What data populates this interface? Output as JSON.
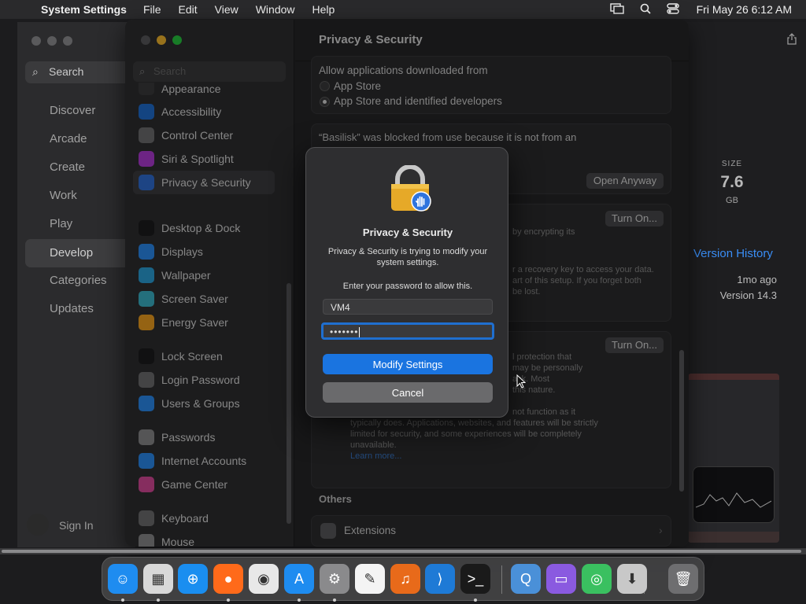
{
  "menubar": {
    "app_name": "System Settings",
    "menus": [
      "File",
      "Edit",
      "View",
      "Window",
      "Help"
    ],
    "clock": "Fri May 26  6:12 AM"
  },
  "appstore": {
    "search_label": "Search",
    "nav": [
      "Discover",
      "Arcade",
      "Create",
      "Work",
      "Play",
      "Develop",
      "Categories",
      "Updates"
    ],
    "active_nav": "Develop",
    "sign_in": "Sign In",
    "size_label": "SIZE",
    "size_value": "7.6",
    "size_unit": "GB",
    "version_history": "Version History",
    "updated_ago": "1mo ago",
    "version": "Version 14.3"
  },
  "settings": {
    "search_placeholder": "Search",
    "sidebar_groups": [
      [
        {
          "label": "Appearance",
          "icon": "appearance-icon",
          "color": "#3a3a3c"
        },
        {
          "label": "Accessibility",
          "icon": "accessibility-icon",
          "color": "#1f6fd0"
        },
        {
          "label": "Control Center",
          "icon": "control-center-icon",
          "color": "#6e6e70"
        },
        {
          "label": "Siri & Spotlight",
          "icon": "siri-icon",
          "color": "#b03bd6"
        },
        {
          "label": "Privacy & Security",
          "icon": "privacy-hand-icon",
          "color": "#2f6fd6"
        }
      ],
      [
        {
          "label": "Desktop & Dock",
          "icon": "desktop-dock-icon",
          "color": "#1c1c1e"
        },
        {
          "label": "Displays",
          "icon": "displays-icon",
          "color": "#2a8cf0"
        },
        {
          "label": "Wallpaper",
          "icon": "wallpaper-icon",
          "color": "#2aa0d8"
        },
        {
          "label": "Screen Saver",
          "icon": "screen-saver-icon",
          "color": "#3ab4c8"
        },
        {
          "label": "Energy Saver",
          "icon": "energy-saver-icon",
          "color": "#f0a020"
        }
      ],
      [
        {
          "label": "Lock Screen",
          "icon": "lock-screen-icon",
          "color": "#1c1c1e"
        },
        {
          "label": "Login Password",
          "icon": "login-password-icon",
          "color": "#6e6e70"
        },
        {
          "label": "Users & Groups",
          "icon": "users-groups-icon",
          "color": "#2a8cf0"
        }
      ],
      [
        {
          "label": "Passwords",
          "icon": "passwords-key-icon",
          "color": "#8a8a8c"
        },
        {
          "label": "Internet Accounts",
          "icon": "internet-accounts-icon",
          "color": "#2a8cf0"
        },
        {
          "label": "Game Center",
          "icon": "game-center-icon",
          "color": "#d84a9a"
        }
      ],
      [
        {
          "label": "Keyboard",
          "icon": "keyboard-icon",
          "color": "#6e6e70"
        },
        {
          "label": "Mouse",
          "icon": "mouse-icon",
          "color": "#8a8a8c"
        }
      ]
    ],
    "active_item": "Privacy & Security",
    "detail_title": "Privacy & Security",
    "allow_label": "Allow applications downloaded from",
    "radio_app_store": "App Store",
    "radio_identified": "App Store and identified developers",
    "blocked_text": "“Basilisk” was blocked from use because it is not from an",
    "open_anyway": "Open Anyway",
    "turn_on_1": "Turn On...",
    "turn_on_2": "Turn On...",
    "filevault_frag_1": "by encrypting its",
    "filevault_frag_2": "r a recovery key to access your data.",
    "filevault_frag_3": "art of this setup. If you forget both",
    "filevault_frag_4": "be lost.",
    "lockdown_frag_1": "l protection that",
    "lockdown_frag_2": "may be personally",
    "lockdown_frag_3": "ack. Most",
    "lockdown_frag_4": "this nature.",
    "lockdown_frag_5": "not function as it",
    "lockdown_body": "typically does. Applications, websites, and features will be strictly limited for security, and some experiences will be completely unavailable.",
    "learn_more": "Learn more...",
    "others_header": "Others",
    "extensions": "Extensions"
  },
  "dialog": {
    "title": "Privacy & Security",
    "message": "Privacy & Security is trying to modify your system settings.",
    "prompt": "Enter your password to allow this.",
    "username": "VM4",
    "password_mask": "•••••••",
    "modify_button": "Modify Settings",
    "cancel_button": "Cancel"
  },
  "dock": {
    "apps": [
      {
        "name": "finder-icon",
        "glyph": "☺",
        "color": "#1e8cf0",
        "running": true
      },
      {
        "name": "launchpad-icon",
        "glyph": "▦",
        "color": "#d8d8d8",
        "running": true
      },
      {
        "name": "safari-icon",
        "glyph": "⊕",
        "color": "#1a8ef0",
        "running": false
      },
      {
        "name": "firefox-icon",
        "glyph": "●",
        "color": "#ff6a1a",
        "running": true
      },
      {
        "name": "chrome-icon",
        "glyph": "◉",
        "color": "#e8e8e8",
        "running": false
      },
      {
        "name": "app-store-icon",
        "glyph": "A",
        "color": "#1e8cf0",
        "running": true
      },
      {
        "name": "system-settings-icon",
        "glyph": "⚙",
        "color": "#8a8a8c",
        "running": true
      },
      {
        "name": "textedit-icon",
        "glyph": "✎",
        "color": "#f4f4f4",
        "running": false
      },
      {
        "name": "garageband-icon",
        "glyph": "♫",
        "color": "#e86a1a",
        "running": false
      },
      {
        "name": "vscode-icon",
        "glyph": "⟩",
        "color": "#1e7ad6",
        "running": false
      },
      {
        "name": "terminal-icon",
        "glyph": ">_",
        "color": "#1a1a1a",
        "running": true
      },
      {
        "name": "quicktime-icon",
        "glyph": "Q",
        "color": "#4a90d8",
        "running": false
      },
      {
        "name": "simulator-icon",
        "glyph": "▭",
        "color": "#8a5ae0",
        "running": false
      },
      {
        "name": "find-my-icon",
        "glyph": "◎",
        "color": "#3ac060",
        "running": false
      },
      {
        "name": "downloads-icon",
        "glyph": "⬇",
        "color": "#c8c8c8",
        "running": false
      },
      {
        "name": "trash-icon",
        "glyph": "🗑",
        "color": "#6e6e70",
        "running": false
      }
    ]
  }
}
